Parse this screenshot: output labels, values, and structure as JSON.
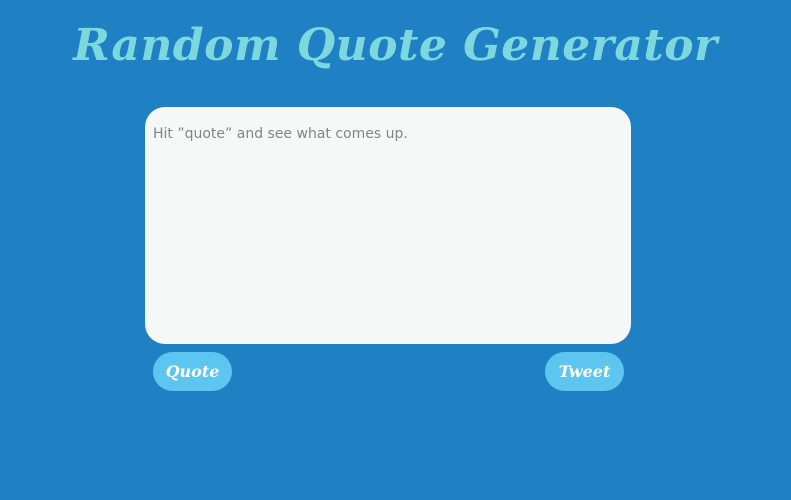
{
  "header": {
    "title": "Random Quote Generator"
  },
  "quote_box": {
    "text": "Hit ”quote” and see what comes up."
  },
  "buttons": {
    "quote_label": "Quote",
    "tweet_label": "Tweet"
  },
  "colors": {
    "background": "#1f80c4",
    "title": "#7dd8dd",
    "box": "#f5f8f6",
    "button": "#5cc6f0",
    "button_text": "#ffffff",
    "quote_text": "#7a8a84"
  }
}
